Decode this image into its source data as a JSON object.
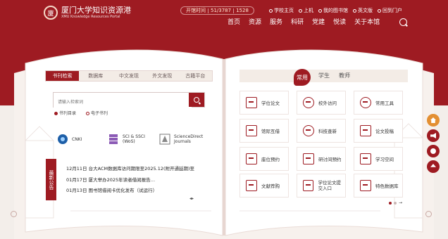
{
  "brand": {
    "seal_glyph": "廈",
    "title": "厦门大学知识资源港",
    "subtitle": "XMU Knowledge Resources Portal"
  },
  "infobar": {
    "status": "开馆时间",
    "count_a": "51/3787",
    "count_b": "1528"
  },
  "quick_links": [
    "学校主页",
    "上机",
    "我的图书馆",
    "英文版",
    "回到门户"
  ],
  "nav": [
    "首页",
    "资源",
    "服务",
    "科研",
    "党建",
    "悦读",
    "关于本馆"
  ],
  "search_tabs": [
    "书刊检索",
    "数据库",
    "中文发现",
    "外文发现",
    "古籍平台"
  ],
  "search": {
    "placeholder": "请输入检索词",
    "options": [
      "书刊目录",
      "电子书刊"
    ]
  },
  "databases": [
    {
      "name": "CNKI",
      "icon": "cnki-globe-icon"
    },
    {
      "name": "SCI & SSCI (WoS)",
      "icon": "database-stack-icon"
    },
    {
      "name": "ScienceDirect Journals",
      "icon": "sciencedirect-tree-icon"
    }
  ],
  "news": {
    "tag": "最新公告",
    "items": [
      {
        "date": "12月11日",
        "text": "台大ACM数据库访问期限至2025.12(附开通延期)至"
      },
      {
        "date": "01月17日",
        "text": "厦大举办2025年读者借阅报告…"
      },
      {
        "date": "01月13日",
        "text": "图书馆借阅卡优化发布（试运行）"
      }
    ]
  },
  "roles": {
    "active": "常用",
    "others": [
      "学生",
      "教师"
    ]
  },
  "services": [
    {
      "label": "学位论文",
      "icon": "thesis-icon"
    },
    {
      "label": "校外访问",
      "icon": "remote-access-icon"
    },
    {
      "label": "常用工具",
      "icon": "tools-icon"
    },
    {
      "label": "馆际互借",
      "icon": "interlibrary-loan-icon"
    },
    {
      "label": "科技查新",
      "icon": "novelty-search-icon"
    },
    {
      "label": "论文投稿",
      "icon": "submission-icon"
    },
    {
      "label": "座位预约",
      "icon": "seat-reservation-icon"
    },
    {
      "label": "研讨间预约",
      "icon": "room-booking-icon"
    },
    {
      "label": "学习空间",
      "icon": "study-space-icon"
    },
    {
      "label": "文献荐购",
      "icon": "recommend-purchase-icon"
    },
    {
      "label": "学位论文提交入口",
      "icon": "thesis-submit-icon"
    },
    {
      "label": "特色数据库",
      "icon": "special-database-icon"
    }
  ],
  "pager": {
    "arrow": "→"
  },
  "colors": {
    "brand": "#9e1b22",
    "accent": "#e38f32",
    "paper": "#ffffff"
  },
  "floating": [
    "home-icon",
    "announcement-icon",
    "clock-icon",
    "arrow-up-icon"
  ]
}
